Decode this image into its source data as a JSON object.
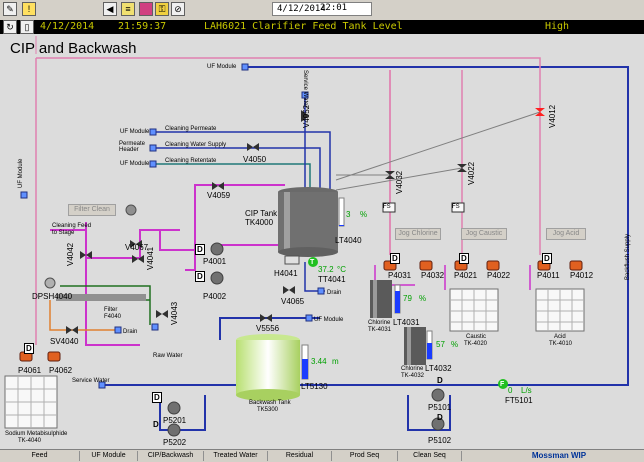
{
  "toolbar": {
    "icons": [
      "edit-icon",
      "alarm-icon",
      "back-icon",
      "script-icon",
      "book-icon",
      "key-icon",
      "stop-icon"
    ],
    "date": "4/12/2014",
    "time": "22:01"
  },
  "alarm": {
    "date": "4/12/2014",
    "time": "21:59:37",
    "message": "LAH6021 Clarifier Feed Tank Level",
    "severity": "High",
    "color": "#c8c800"
  },
  "page": {
    "title": "CIP and Backwash"
  },
  "labels": {
    "uf_module": "UF Module",
    "cleaning_permeate": "Cleaning Permeate",
    "permeate_header": "Permeate Header",
    "cleaning_water_supply": "Cleaning Water Supply",
    "cleaning_retentate": "Cleaning Retentate",
    "service_water_v": "Service Water",
    "uf_module_v": "UF Module",
    "cleaning_feed": "Cleaning Feed to Stage",
    "drain": "Drain",
    "raw_water": "Raw Water",
    "service_water": "Service Water",
    "backflush_supply": "Backflush Supply"
  },
  "buttons": {
    "filter_clean": "Filter Clean",
    "jog_chlorine": "Jog Chlorine",
    "jog_caustic": "Jog Caustic",
    "jog_acid": "Jog Acid"
  },
  "valves": {
    "v4052": "V4052",
    "v4050": "V4050",
    "v4059": "V4059",
    "v4067": "V4067",
    "v4041": "V4041",
    "v4042": "V4042",
    "v4043": "V4043",
    "sv4040": "SV4040",
    "v4065": "V4065",
    "v5556": "V5556",
    "v4032": "V4032",
    "v4022": "V4022",
    "v4012": "V4012"
  },
  "pumps": {
    "p4001": "P4001",
    "p4002": "P4002",
    "p4061": "P4061",
    "p4062": "P4062",
    "p4031": "P4031",
    "p4032": "P4032",
    "p4021": "P4021",
    "p4022": "P4022",
    "p4011": "P4011",
    "p4012": "P4012",
    "p5201": "P5201",
    "p5202": "P5202",
    "p5101": "P5101",
    "p5102": "P5102"
  },
  "equipment": {
    "cip_tank": "CIP Tank",
    "cip_tank_id": "TK4000",
    "filter": "Filter",
    "filter_id": "F4040",
    "dpsh": "DPSH4040",
    "h4041": "H4041",
    "tt4041": "TT4041",
    "lt4040": "LT4040",
    "lt4031": "LT4031",
    "lt4032": "LT4032",
    "lt5130": "LT5130",
    "chlorine1": "Chlorine",
    "chlorine1_id": "TK-4031",
    "chlorine2": "Chlorine",
    "chlorine2_id": "TK-4032",
    "caustic": "Caustic",
    "caustic_id": "TK-4020",
    "acid": "Acid",
    "acid_id": "TK-4010",
    "backwash_tank": "Backwash Tank",
    "backwash_tank_id": "TK5300",
    "sodium": "Sodium Metabisulphide",
    "sodium_id": "TK-4040",
    "ft5101": "FT5101",
    "fs": "FS"
  },
  "readings": {
    "lt4040_value": "3",
    "lt4040_unit": "%",
    "temperature": "37.2",
    "temperature_unit": "°C",
    "lt4031_value": "79",
    "lt4031_unit": "%",
    "lt4032_value": "57",
    "lt4032_unit": "%",
    "lt5130_value": "3.44",
    "lt5130_unit": "m",
    "ft5101_value": "0",
    "ft5101_unit": "L/s",
    "lt4040_level": 0.03,
    "lt4031_level": 0.79,
    "lt4032_level": 0.57,
    "lt5130_level": 0.6
  },
  "badges": {
    "d": "D",
    "t": "T",
    "f": "F"
  },
  "navigation": [
    "Feed",
    "UF Module",
    "CIP/Backwash",
    "Treated Water",
    "Residual",
    "Prod Seq",
    "Clean Seq"
  ],
  "brand": "Mossman WIP",
  "colors": {
    "pipe_magenta": "#cc33cc",
    "pipe_blue": "#2233aa",
    "pipe_teal": "#207878",
    "pipe_orange": "#e08030",
    "pipe_pink": "#e080b0",
    "pipe_green": "#207020",
    "level_blue": "#1a3cff",
    "valve_red": "#ff2020"
  }
}
